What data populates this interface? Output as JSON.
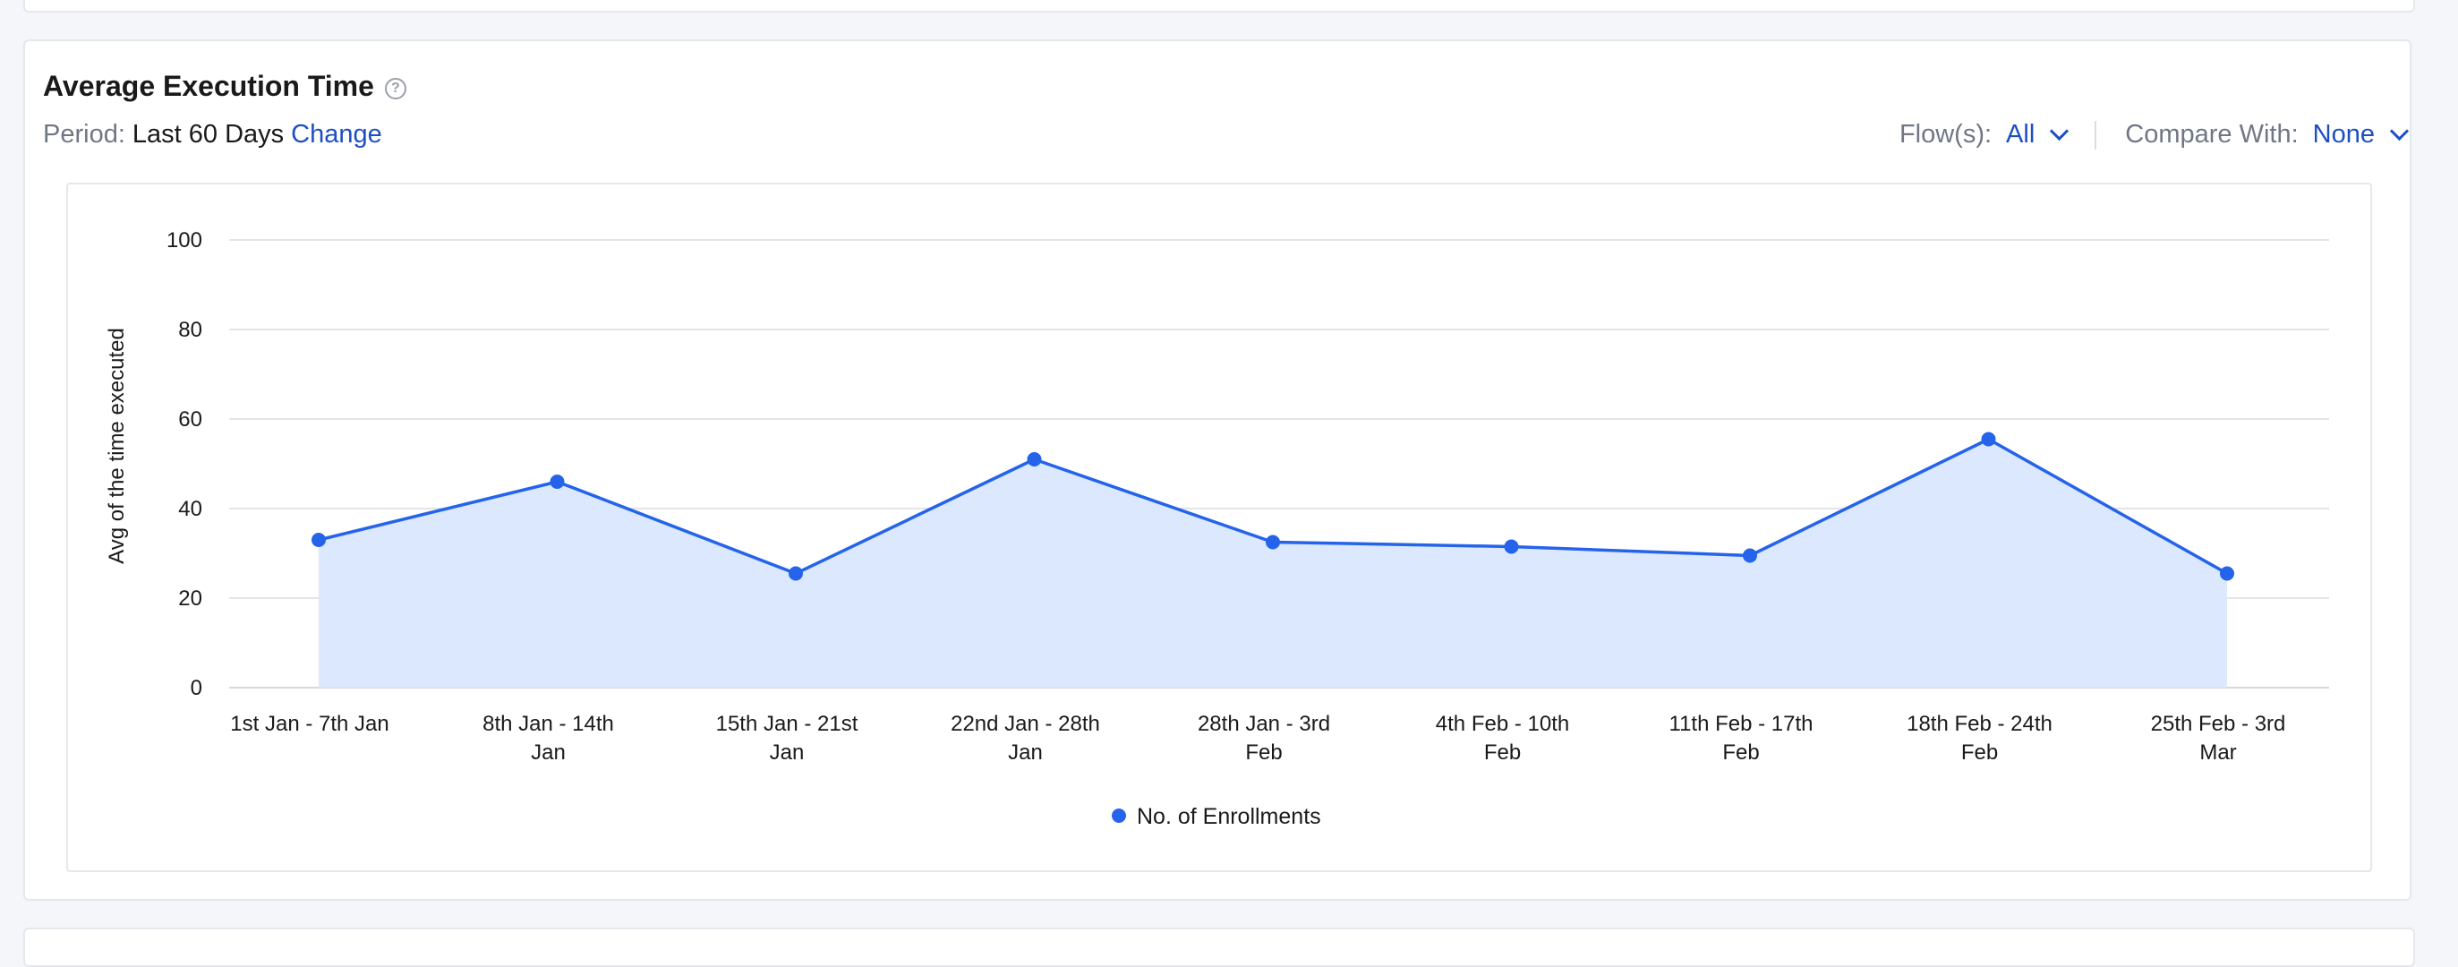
{
  "section": {
    "title": "Average Execution Time",
    "help_icon": "question-circle-icon"
  },
  "period": {
    "label": "Period:",
    "value": "Last 60 Days",
    "change_link": "Change"
  },
  "filters": {
    "flows_label": "Flow(s):",
    "flows_value": "All",
    "compare_label": "Compare With:",
    "compare_value": "None"
  },
  "colors": {
    "line": "#2563eb",
    "area": "#dbe8fd",
    "grid": "#e3e5e8",
    "link": "#1d4fc4"
  },
  "chart_data": {
    "type": "area",
    "ylabel": "Avg of the time executed",
    "xlabel": "",
    "ylim": [
      0,
      100
    ],
    "yticks": [
      0,
      20,
      40,
      60,
      80,
      100
    ],
    "grid": true,
    "legend_position": "bottom-center",
    "categories": [
      [
        "1st Jan - 7th Jan"
      ],
      [
        "8th Jan - 14th",
        "Jan"
      ],
      [
        "15th Jan - 21st",
        "Jan"
      ],
      [
        "22nd Jan - 28th",
        "Jan"
      ],
      [
        "28th Jan - 3rd",
        "Feb"
      ],
      [
        "4th Feb - 10th",
        "Feb"
      ],
      [
        "11th Feb - 17th",
        "Feb"
      ],
      [
        "18th Feb - 24th",
        "Feb"
      ],
      [
        "25th Feb - 3rd",
        "Mar"
      ]
    ],
    "series": [
      {
        "name": "No. of Enrollments",
        "values": [
          33,
          46,
          25.5,
          51,
          32.5,
          31.5,
          29.5,
          55.5,
          25.5
        ]
      }
    ]
  }
}
